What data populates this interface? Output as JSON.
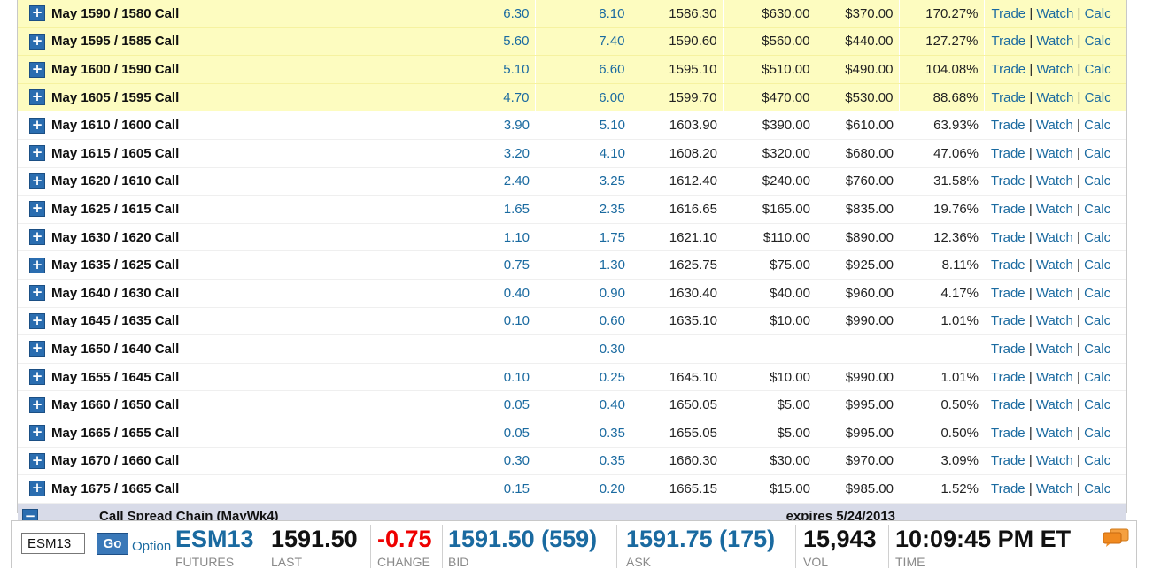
{
  "rows": [
    {
      "name": "May 1590 / 1580 Call",
      "bid": "6.30",
      "ask": "8.10",
      "breakeven": "1586.30",
      "maxloss": "$630.00",
      "maxgain": "$370.00",
      "ret": "170.27%",
      "hl": true
    },
    {
      "name": "May 1595 / 1585 Call",
      "bid": "5.60",
      "ask": "7.40",
      "breakeven": "1590.60",
      "maxloss": "$560.00",
      "maxgain": "$440.00",
      "ret": "127.27%",
      "hl": true
    },
    {
      "name": "May 1600 / 1590 Call",
      "bid": "5.10",
      "ask": "6.60",
      "breakeven": "1595.10",
      "maxloss": "$510.00",
      "maxgain": "$490.00",
      "ret": "104.08%",
      "hl": true
    },
    {
      "name": "May 1605 / 1595 Call",
      "bid": "4.70",
      "ask": "6.00",
      "breakeven": "1599.70",
      "maxloss": "$470.00",
      "maxgain": "$530.00",
      "ret": "88.68%",
      "hl": true
    },
    {
      "name": "May 1610 / 1600 Call",
      "bid": "3.90",
      "ask": "5.10",
      "breakeven": "1603.90",
      "maxloss": "$390.00",
      "maxgain": "$610.00",
      "ret": "63.93%",
      "hl": false
    },
    {
      "name": "May 1615 / 1605 Call",
      "bid": "3.20",
      "ask": "4.10",
      "breakeven": "1608.20",
      "maxloss": "$320.00",
      "maxgain": "$680.00",
      "ret": "47.06%",
      "hl": false
    },
    {
      "name": "May 1620 / 1610 Call",
      "bid": "2.40",
      "ask": "3.25",
      "breakeven": "1612.40",
      "maxloss": "$240.00",
      "maxgain": "$760.00",
      "ret": "31.58%",
      "hl": false
    },
    {
      "name": "May 1625 / 1615 Call",
      "bid": "1.65",
      "ask": "2.35",
      "breakeven": "1616.65",
      "maxloss": "$165.00",
      "maxgain": "$835.00",
      "ret": "19.76%",
      "hl": false
    },
    {
      "name": "May 1630 / 1620 Call",
      "bid": "1.10",
      "ask": "1.75",
      "breakeven": "1621.10",
      "maxloss": "$110.00",
      "maxgain": "$890.00",
      "ret": "12.36%",
      "hl": false
    },
    {
      "name": "May 1635 / 1625 Call",
      "bid": "0.75",
      "ask": "1.30",
      "breakeven": "1625.75",
      "maxloss": "$75.00",
      "maxgain": "$925.00",
      "ret": "8.11%",
      "hl": false
    },
    {
      "name": "May 1640 / 1630 Call",
      "bid": "0.40",
      "ask": "0.90",
      "breakeven": "1630.40",
      "maxloss": "$40.00",
      "maxgain": "$960.00",
      "ret": "4.17%",
      "hl": false
    },
    {
      "name": "May 1645 / 1635 Call",
      "bid": "0.10",
      "ask": "0.60",
      "breakeven": "1635.10",
      "maxloss": "$10.00",
      "maxgain": "$990.00",
      "ret": "1.01%",
      "hl": false
    },
    {
      "name": "May 1650 / 1640 Call",
      "bid": "",
      "ask": "0.30",
      "breakeven": "",
      "maxloss": "",
      "maxgain": "",
      "ret": "",
      "hl": false
    },
    {
      "name": "May 1655 / 1645 Call",
      "bid": "0.10",
      "ask": "0.25",
      "breakeven": "1645.10",
      "maxloss": "$10.00",
      "maxgain": "$990.00",
      "ret": "1.01%",
      "hl": false
    },
    {
      "name": "May 1660 / 1650 Call",
      "bid": "0.05",
      "ask": "0.40",
      "breakeven": "1650.05",
      "maxloss": "$5.00",
      "maxgain": "$995.00",
      "ret": "0.50%",
      "hl": false
    },
    {
      "name": "May 1665 / 1655 Call",
      "bid": "0.05",
      "ask": "0.35",
      "breakeven": "1655.05",
      "maxloss": "$5.00",
      "maxgain": "$995.00",
      "ret": "0.50%",
      "hl": false
    },
    {
      "name": "May 1670 / 1660 Call",
      "bid": "0.30",
      "ask": "0.35",
      "breakeven": "1660.30",
      "maxloss": "$30.00",
      "maxgain": "$970.00",
      "ret": "3.09%",
      "hl": false
    },
    {
      "name": "May 1675 / 1665 Call",
      "bid": "0.15",
      "ask": "0.20",
      "breakeven": "1665.15",
      "maxloss": "$15.00",
      "maxgain": "$985.00",
      "ret": "1.52%",
      "hl": false
    }
  ],
  "links": {
    "trade": "Trade",
    "watch": "Watch",
    "calc": "Calc",
    "sep": "|"
  },
  "expand_icon": "plus-square-icon",
  "collapse_icon": "minus-square-icon",
  "footer": {
    "title": "Call Spread Chain (MayWk4)",
    "expires": "expires 5/24/2013"
  },
  "quote": {
    "symbol_input": "ESM13",
    "go_label": "Go",
    "option_label": "Option",
    "symbol": "ESM13",
    "symbol_label": "FUTURES",
    "last": "1591.50",
    "last_label": "LAST",
    "change": "-0.75",
    "change_label": "CHANGE",
    "bid": "1591.50 (559)",
    "bid_label": "BID",
    "ask": "1591.75 (175)",
    "ask_label": "ASK",
    "vol": "15,943",
    "vol_label": "VOL",
    "time": "10:09:45 PM ET",
    "time_label": "TIME",
    "chat_icon": "chat-bubbles-icon"
  },
  "colors": {
    "highlight": "#fdfcc0",
    "link": "#1a6aa0",
    "negative": "#e00000",
    "footer_bg": "#d8dbe8",
    "button": "#2a6db0"
  }
}
